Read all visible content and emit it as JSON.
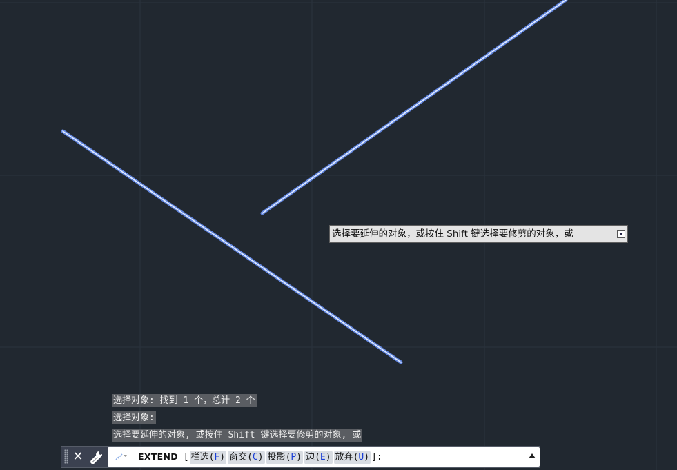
{
  "tooltip": {
    "text": "选择要延伸的对象，或按住 Shift 键选择要修剪的对象，或",
    "icon": "expand-down-icon"
  },
  "history": [
    "选择对象: 找到 1 个，总计 2 个",
    "选择对象:",
    "选择要延伸的对象, 或按住 Shift 键选择要修剪的对象, 或"
  ],
  "command_line": {
    "close_icon": "close-icon",
    "close_glyph": "✕",
    "customize_icon": "wrench-icon",
    "command_icon": "command-options-icon",
    "command": "EXTEND",
    "open_bracket": "[",
    "options": [
      {
        "label": "栏选",
        "key": "F"
      },
      {
        "label": "窗交",
        "key": "C"
      },
      {
        "label": "投影",
        "key": "P"
      },
      {
        "label": "边",
        "key": "E"
      },
      {
        "label": "放弃",
        "key": "U"
      }
    ],
    "close_bracket": "]:",
    "recent_icon": "caret-up-icon"
  },
  "colors": {
    "canvas": "#212830",
    "grid": "#2b333e",
    "line": "#7ea6ff",
    "line_core": "#e6efff"
  }
}
